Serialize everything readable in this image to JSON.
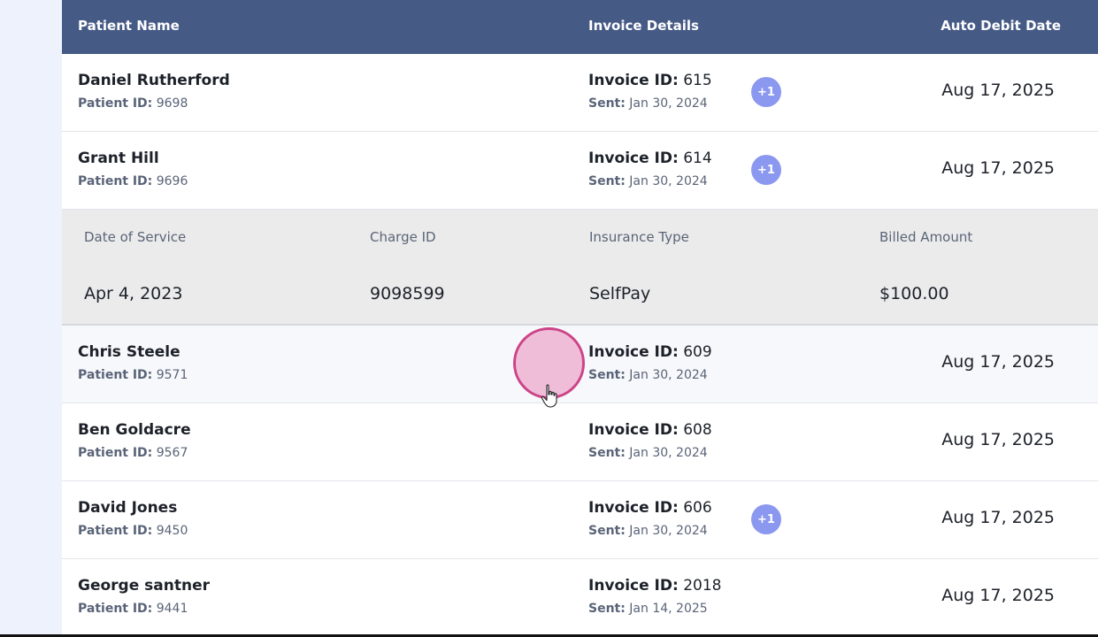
{
  "header": {
    "patient_name": "Patient Name",
    "invoice_details": "Invoice Details",
    "auto_debit_date": "Auto Debit Date"
  },
  "labels": {
    "patient_id": "Patient ID:",
    "invoice_id": "Invoice ID:",
    "sent": "Sent:"
  },
  "rows": [
    {
      "name": "Daniel Rutherford",
      "patient_id": "9698",
      "invoice_id": "615",
      "sent": "Jan 30, 2024",
      "badge": "+1",
      "debit_date": "Aug 17, 2025"
    },
    {
      "name": "Grant Hill",
      "patient_id": "9696",
      "invoice_id": "614",
      "sent": "Jan 30, 2024",
      "badge": "+1",
      "debit_date": "Aug 17, 2025"
    },
    {
      "name": "Chris Steele",
      "patient_id": "9571",
      "invoice_id": "609",
      "sent": "Jan 30, 2024",
      "badge": "",
      "debit_date": "Aug 17, 2025"
    },
    {
      "name": "Ben Goldacre",
      "patient_id": "9567",
      "invoice_id": "608",
      "sent": "Jan 30, 2024",
      "badge": "",
      "debit_date": "Aug 17, 2025"
    },
    {
      "name": "David Jones",
      "patient_id": "9450",
      "invoice_id": "606",
      "sent": "Jan 30, 2024",
      "badge": "+1",
      "debit_date": "Aug 17, 2025"
    },
    {
      "name": "George santner",
      "patient_id": "9441",
      "invoice_id": "2018",
      "sent": "Jan 14, 2025",
      "badge": "",
      "debit_date": "Aug 17, 2025"
    }
  ],
  "detail": {
    "headers": {
      "date_of_service": "Date of Service",
      "charge_id": "Charge ID",
      "insurance_type": "Insurance Type",
      "billed_amount": "Billed Amount"
    },
    "values": {
      "date_of_service": "Apr 4, 2023",
      "charge_id": "9098599",
      "insurance_type": "SelfPay",
      "billed_amount": "$100.00"
    }
  },
  "colors": {
    "header_bg": "#465a86",
    "badge_bg": "#8b98ef",
    "detail_bg": "#ebebeb",
    "cursor_ring": "#cc4488"
  }
}
